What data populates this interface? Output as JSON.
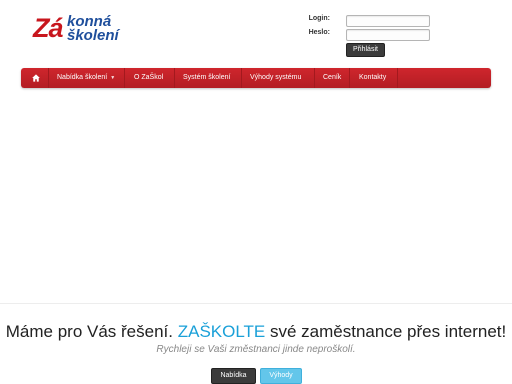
{
  "logo": {
    "za": "Zá",
    "line1": "konná",
    "line2": "školení"
  },
  "login": {
    "login_label": "Login:",
    "password_label": "Heslo:",
    "submit_label": "Přihlásit"
  },
  "nav": {
    "home_icon": "home-icon",
    "items": [
      {
        "label": "Nabídka školení",
        "has_dropdown": true
      },
      {
        "label": "O ZaŠkol"
      },
      {
        "label": "Systém školení"
      },
      {
        "label": "Výhody systému"
      },
      {
        "label": "Ceník"
      },
      {
        "label": "Kontakty"
      }
    ]
  },
  "banner": {
    "headline_part1": "Máme pro Vás řešení. ",
    "headline_accent": "ZAŠKOLTE",
    "headline_part2": " své zaměstnance přes internet!",
    "subline": "Rychleji se Vaši změstnanci jinde neproškolí.",
    "button_offer": "Nabídka",
    "button_benefits": "Výhody"
  },
  "colors": {
    "brand_red": "#c8161d",
    "brand_blue": "#1f4f9c",
    "accent_cyan": "#1aa0d8",
    "button_dark": "#3b3b3b",
    "button_light": "#63c6ea"
  }
}
